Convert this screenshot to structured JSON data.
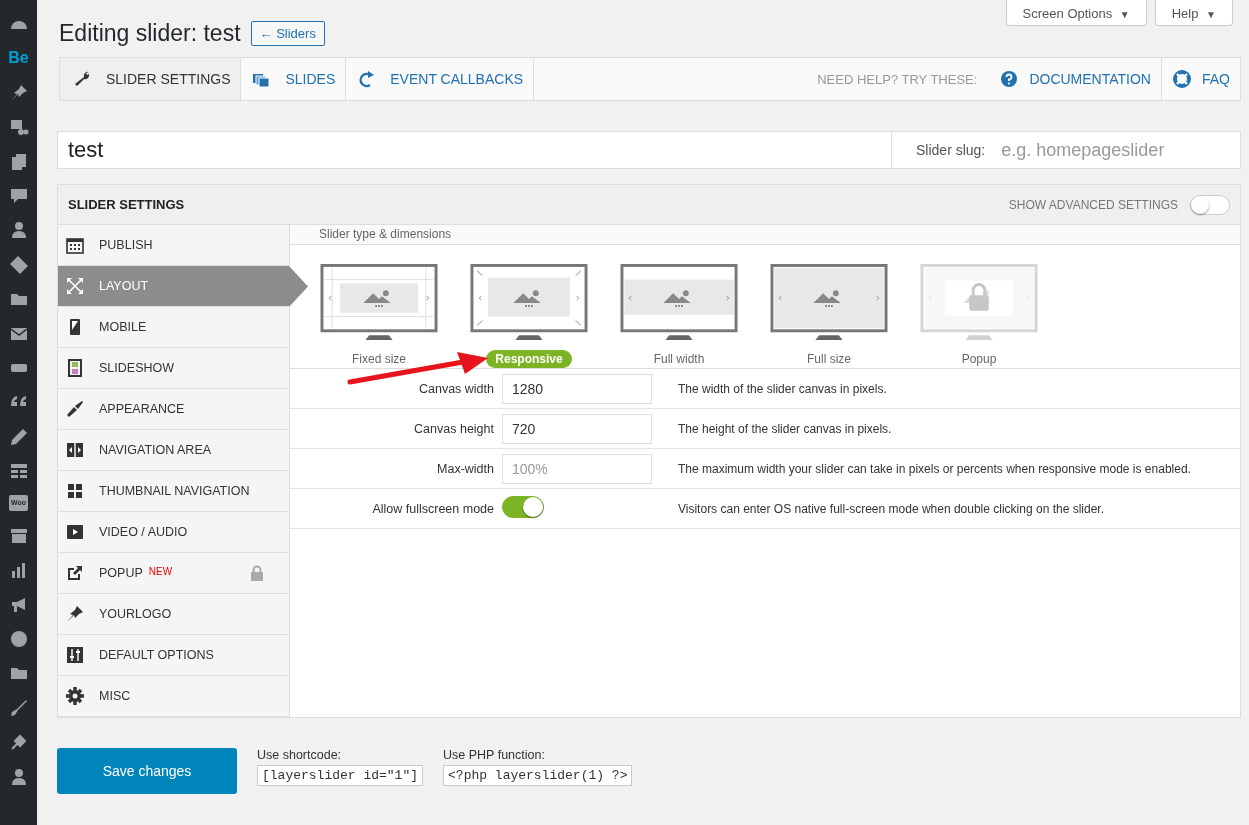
{
  "admin_menu": [
    {
      "kind": "dashboard"
    },
    {
      "kind": "text",
      "label": "Be"
    },
    {
      "kind": "pin"
    },
    {
      "kind": "media"
    },
    {
      "kind": "pages"
    },
    {
      "kind": "comment"
    },
    {
      "kind": "user"
    },
    {
      "kind": "tag"
    },
    {
      "kind": "folder"
    },
    {
      "kind": "mail"
    },
    {
      "kind": "slider"
    },
    {
      "kind": "quote"
    },
    {
      "kind": "pencil"
    },
    {
      "kind": "table"
    },
    {
      "kind": "woo",
      "label": "Woo"
    },
    {
      "kind": "archive"
    },
    {
      "kind": "chart"
    },
    {
      "kind": "megaphone"
    },
    {
      "kind": "circle"
    },
    {
      "kind": "folder"
    },
    {
      "kind": "brush"
    },
    {
      "kind": "plug"
    },
    {
      "kind": "user"
    }
  ],
  "header": {
    "title": "Editing slider: test",
    "back_button": "← Sliders",
    "screen_options": "Screen Options",
    "help": "Help",
    "caret": "▼"
  },
  "tabs": [
    {
      "kind": "wrench",
      "label": "SLIDER SETTINGS",
      "selected": true
    },
    {
      "kind": "slides",
      "label": "SLIDES",
      "selected": false
    },
    {
      "kind": "redo",
      "label": "EVENT CALLBACKS",
      "selected": false
    }
  ],
  "help": {
    "label": "NEED HELP? TRY THESE:",
    "links": [
      {
        "kind": "question",
        "label": "DOCUMENTATION"
      },
      {
        "kind": "lifebuoy",
        "label": "FAQ"
      }
    ]
  },
  "slider_name": {
    "value": "test",
    "slug_label": "Slider slug:",
    "slug_placeholder": "e.g. homepageslider"
  },
  "settings": {
    "title": "SLIDER SETTINGS",
    "advanced_label": "SHOW ADVANCED SETTINGS",
    "advanced_on": false,
    "nav": [
      {
        "kind": "calendar",
        "label": "PUBLISH",
        "selected": false
      },
      {
        "kind": "expand",
        "label": "LAYOUT",
        "selected": true
      },
      {
        "kind": "phone",
        "label": "MOBILE",
        "selected": false
      },
      {
        "kind": "film",
        "label": "SLIDESHOW",
        "selected": false
      },
      {
        "kind": "brush",
        "label": "APPEARANCE",
        "selected": false
      },
      {
        "kind": "navarrows",
        "label": "NAVIGATION AREA",
        "selected": false
      },
      {
        "kind": "grid",
        "label": "THUMBNAIL NAVIGATION",
        "selected": false
      },
      {
        "kind": "play",
        "label": "VIDEO / AUDIO",
        "selected": false
      },
      {
        "kind": "external",
        "label": "POPUP",
        "badge": "NEW",
        "locked": true,
        "selected": false
      },
      {
        "kind": "pin",
        "label": "YOURLOGO",
        "selected": false
      },
      {
        "kind": "sliders",
        "label": "DEFAULT OPTIONS",
        "selected": false
      },
      {
        "kind": "gear",
        "label": "MISC",
        "selected": false
      }
    ],
    "section_title": "Slider type & dimensions",
    "types": [
      {
        "kind": "fixed",
        "label": "Fixed size",
        "selected": false,
        "disabled": false
      },
      {
        "kind": "responsive",
        "label": "Responsive",
        "selected": true,
        "disabled": false
      },
      {
        "kind": "fullwidth",
        "label": "Full width",
        "selected": false,
        "disabled": false
      },
      {
        "kind": "fullsize",
        "label": "Full size",
        "selected": false,
        "disabled": false
      },
      {
        "kind": "popup",
        "label": "Popup",
        "selected": false,
        "disabled": true
      }
    ],
    "fields": [
      {
        "kind": "input",
        "label": "Canvas width",
        "value": "1280",
        "description": "The width of the slider canvas in pixels."
      },
      {
        "kind": "input",
        "label": "Canvas height",
        "value": "720",
        "description": "The height of the slider canvas in pixels."
      },
      {
        "kind": "input",
        "label": "Max-width",
        "placeholder": "100%",
        "description": "The maximum width your slider can take in pixels or percents when responsive mode is enabled."
      },
      {
        "kind": "toggle",
        "label": "Allow fullscreen mode",
        "on": true,
        "description": "Visitors can enter OS native full-screen mode when double clicking on the slider."
      }
    ]
  },
  "footer": {
    "save": "Save changes",
    "shortcode_label": "Use shortcode:",
    "shortcode": "[layerslider id=\"1\"]",
    "php_label": "Use PHP function:",
    "php": "<?php layerslider(1) ?>"
  }
}
